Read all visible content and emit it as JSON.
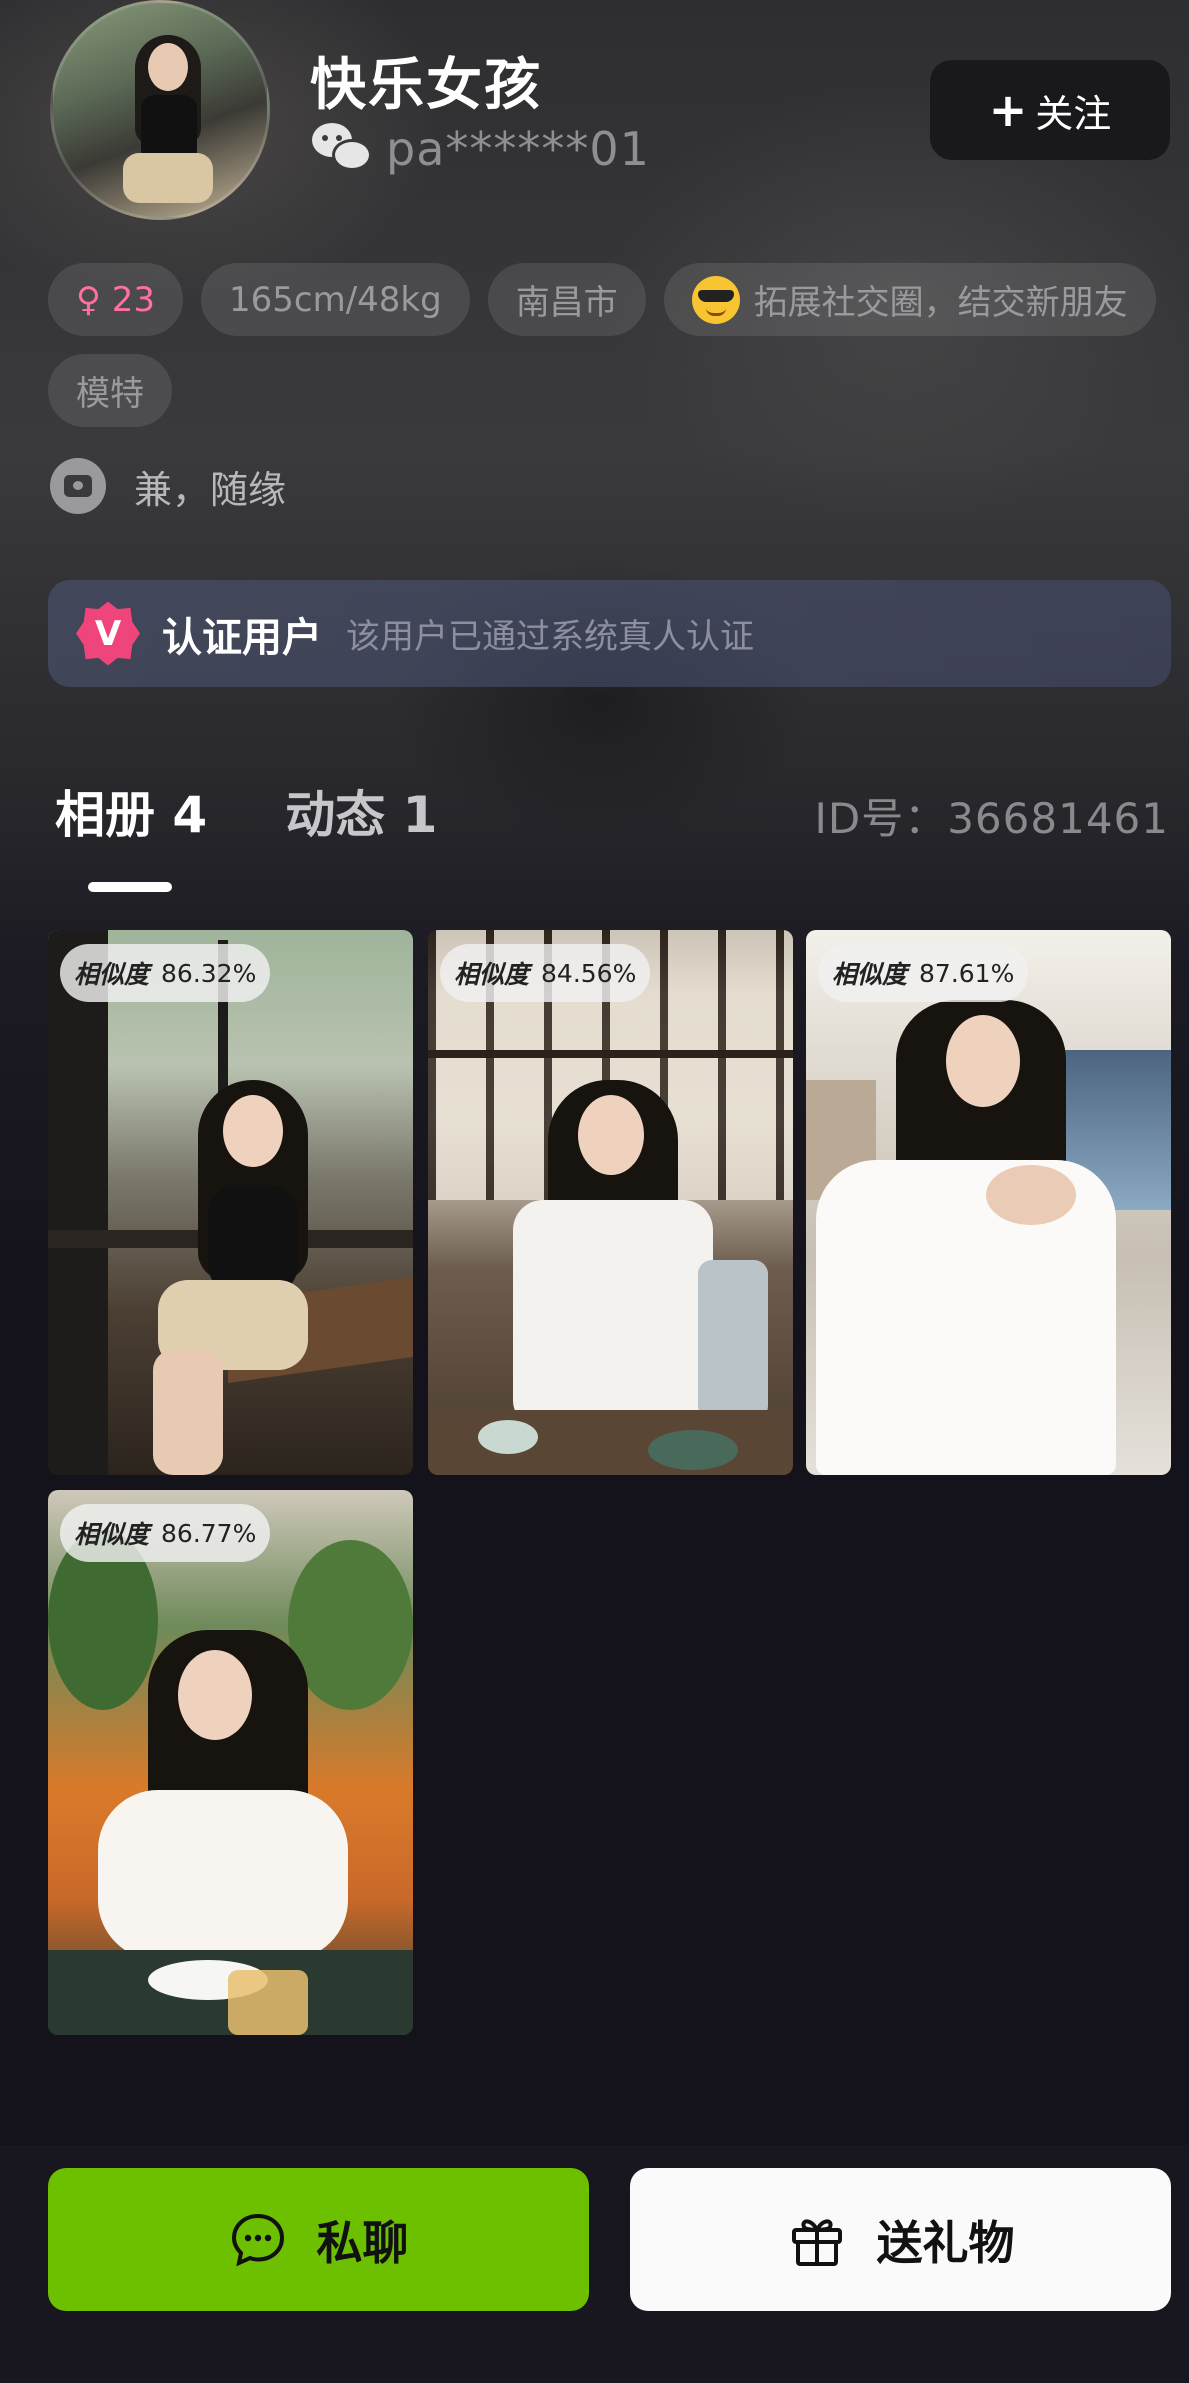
{
  "profile": {
    "name": "快乐女孩",
    "wechat_id": "pa******01",
    "follow_label": "关注",
    "follow_icon": "plus-icon"
  },
  "tags": {
    "gender_age": "♀ 23",
    "body": "165cm/48kg",
    "city": "南昌市",
    "purpose": "拓展社交圈，结交新朋友",
    "purpose_emoji": "sunglasses-emoji",
    "job": "模特"
  },
  "signature": {
    "icon": "chat-heart-icon",
    "text": "兼，随缘"
  },
  "verification": {
    "badge": "V",
    "title": "认证用户",
    "description": "该用户已通过系统真人认证"
  },
  "tabs": [
    {
      "label": "相册 4",
      "active": true
    },
    {
      "label": "动态 1",
      "active": false
    }
  ],
  "user_id": "ID号：36681461",
  "album": {
    "similarity_label": "相似度",
    "photos": [
      {
        "similarity": "86.32%"
      },
      {
        "similarity": "84.56%"
      },
      {
        "similarity": "87.61%"
      },
      {
        "similarity": "86.77%"
      }
    ]
  },
  "actions": {
    "chat_label": "私聊",
    "gift_label": "送礼物"
  },
  "colors": {
    "accent_green": "#6cc000",
    "female_pink": "#ff6fa0",
    "verify_badge": "#f0457a"
  }
}
